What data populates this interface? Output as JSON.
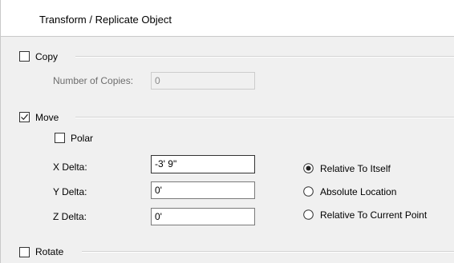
{
  "dialog": {
    "title": "Transform / Replicate Object"
  },
  "copy": {
    "label": "Copy",
    "checked": false,
    "number_of_copies_label": "Number of Copies:",
    "number_of_copies_value": "0"
  },
  "move": {
    "label": "Move",
    "checked": true,
    "polar_label": "Polar",
    "polar_checked": false,
    "x_delta_label": "X Delta:",
    "x_delta_value": "-3' 9\"",
    "y_delta_label": "Y Delta:",
    "y_delta_value": "0'",
    "z_delta_label": "Z Delta:",
    "z_delta_value": "0'",
    "reference_options": [
      {
        "label": "Relative To Itself",
        "selected": true
      },
      {
        "label": "Absolute Location",
        "selected": false
      },
      {
        "label": "Relative To Current Point",
        "selected": false
      }
    ]
  },
  "rotate": {
    "label": "Rotate",
    "checked": false
  }
}
